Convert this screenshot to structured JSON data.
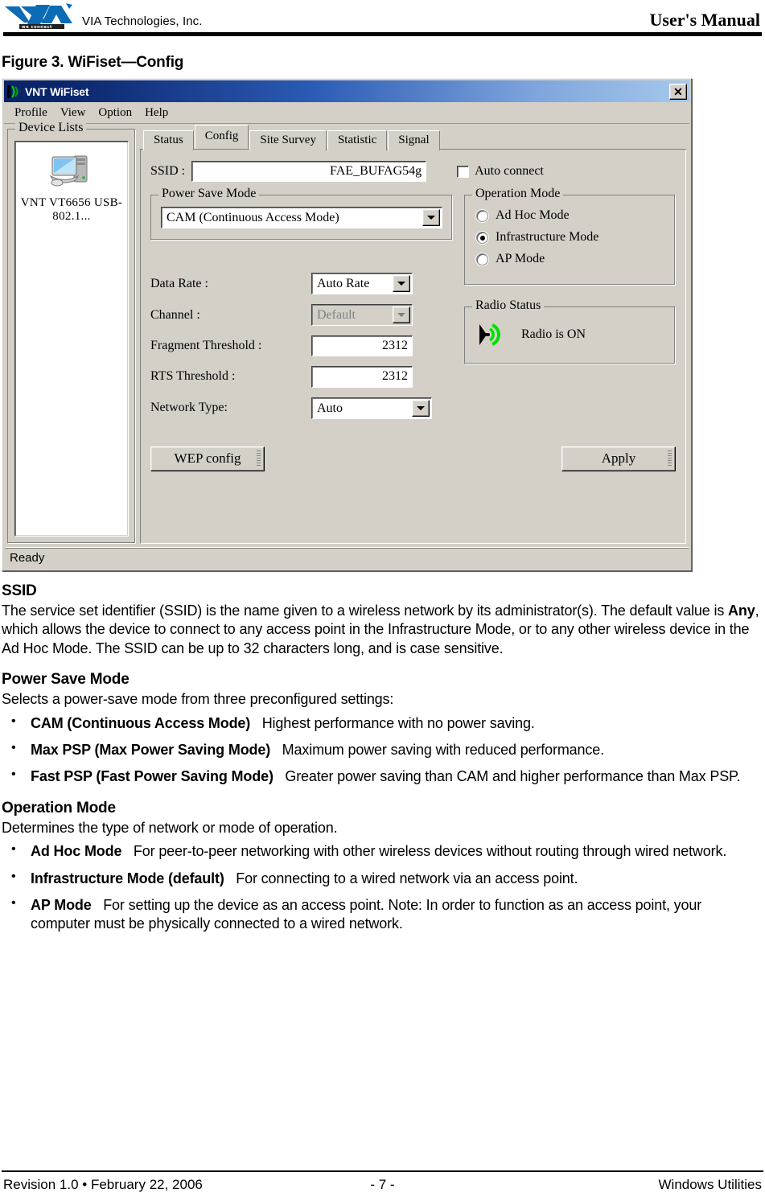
{
  "header": {
    "company": "VIA Technologies, Inc.",
    "manual_title": "User's Manual",
    "logo_alt": "via-logo"
  },
  "figure": {
    "caption": "Figure 3. WiFiset—Config"
  },
  "app_window": {
    "title": "VNT WiFiset",
    "close_label": "✕",
    "menu": [
      {
        "label": "Profile"
      },
      {
        "label": "View"
      },
      {
        "label": "Option"
      },
      {
        "label": "Help"
      }
    ],
    "device_lists": {
      "group_label": "Device Lists",
      "item_label": "VNT VT6656 USB-802.1..."
    },
    "tabs": [
      {
        "label": "Status",
        "active": false
      },
      {
        "label": "Config",
        "active": true
      },
      {
        "label": "Site Survey",
        "active": false
      },
      {
        "label": "Statistic",
        "active": false
      },
      {
        "label": "Signal",
        "active": false
      }
    ],
    "config": {
      "ssid_label": "SSID :",
      "ssid_value": "FAE_BUFAG54g",
      "auto_connect_label": "Auto connect",
      "auto_connect_checked": false,
      "power_save_group": "Power Save Mode",
      "power_save_value": "CAM (Continuous Access Mode)",
      "power_save_options": [
        "CAM (Continuous Access Mode)",
        "Max PSP (Max Power Saving Mode)",
        "Fast PSP (Fast Power Saving Mode)"
      ],
      "data_rate_label": "Data Rate :",
      "data_rate_value": "Auto Rate",
      "channel_label": "Channel :",
      "channel_value": "Default",
      "channel_disabled": true,
      "fragment_label": "Fragment Threshold :",
      "fragment_value": "2312",
      "rts_label": "RTS Threshold :",
      "rts_value": "2312",
      "network_type_label": "Network Type:",
      "network_type_value": "Auto",
      "operation_mode_group": "Operation Mode",
      "operation_modes": [
        {
          "label": "Ad Hoc Mode",
          "selected": false
        },
        {
          "label": "Infrastructure Mode",
          "selected": true
        },
        {
          "label": "AP Mode",
          "selected": false
        }
      ],
      "radio_status_group": "Radio Status",
      "radio_status_text": "Radio is ON",
      "radio_on_color": "#00e000",
      "wep_button": "WEP config",
      "apply_button": "Apply"
    },
    "statusbar": "Ready"
  },
  "body": {
    "ssid": {
      "heading": "SSID",
      "paragraph": "The service set identifier (SSID) is the name given to a wireless network by its administrator(s). The default value is Any, which allows the device to connect to any access point in the Infrastructure Mode, or to any other wireless device in the Ad Hoc Mode. The SSID can be up to 32 characters long, and is case sensitive.",
      "para_pre": "The service set identifier (SSID) is the name given to a wireless network by its administrator(s). The default value is ",
      "para_bold": "Any",
      "para_post": ", which allows the device to connect to any access point in the Infrastructure Mode, or to any other wireless device in the Ad Hoc Mode. The SSID can be up to 32 characters long, and is case sensitive."
    },
    "power_save": {
      "heading": "Power Save Mode",
      "intro": "Selects a power-save mode from three preconfigured settings:",
      "bullets": [
        {
          "term": "CAM (Continuous Access Mode)",
          "desc": "Highest performance with no power saving."
        },
        {
          "term": "Max PSP (Max Power Saving Mode)",
          "desc": "Maximum power saving with reduced performance."
        },
        {
          "term": "Fast PSP (Fast Power Saving Mode)",
          "desc": "Greater power saving than CAM and higher performance than Max PSP."
        }
      ]
    },
    "operation_mode": {
      "heading": "Operation Mode",
      "intro": "Determines the type of network or mode of operation.",
      "bullets": [
        {
          "term": "Ad Hoc Mode",
          "desc": "For peer-to-peer networking with other wireless devices without routing through wired network."
        },
        {
          "term": "Infrastructure Mode (default)",
          "desc": "For connecting to a wired network via an access point."
        },
        {
          "term": "AP Mode",
          "desc": "For setting up the device as an access point. Note: In order to function as an access point, your computer must be physically connected to a wired network."
        }
      ]
    }
  },
  "footer": {
    "revision": "Revision 1.0 • February 22, 2006",
    "page": "- 7 -",
    "section": "Windows Utilities"
  }
}
